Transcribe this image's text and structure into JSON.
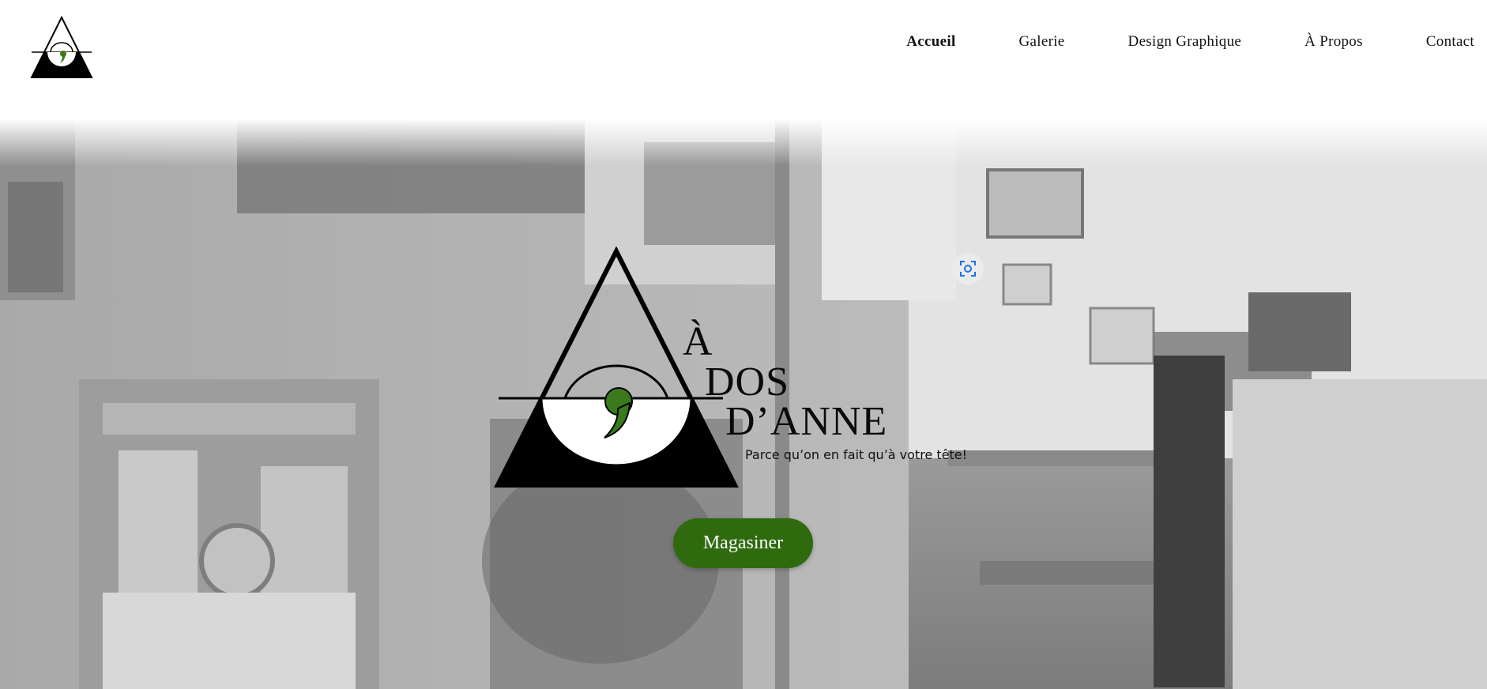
{
  "header": {
    "logo_icon": "triangle-eye-comma-logo"
  },
  "nav": {
    "items": [
      {
        "label": "Accueil",
        "active": true
      },
      {
        "label": "Galerie",
        "active": false
      },
      {
        "label": "Design Graphique",
        "active": false
      },
      {
        "label": "À Propos",
        "active": false
      },
      {
        "label": "Contact",
        "active": false
      }
    ]
  },
  "hero": {
    "brand": {
      "line1": "À",
      "line2": "DOS",
      "line3": "D’ANNE"
    },
    "tagline": "Parce qu’on en fait qu’à votre tête!",
    "cta_label": "Magasiner",
    "scan_icon": "visual-search-icon"
  },
  "colors": {
    "accent_green": "#2f6a0f",
    "logo_comma_green": "#3a7a1c",
    "text": "#111111"
  }
}
